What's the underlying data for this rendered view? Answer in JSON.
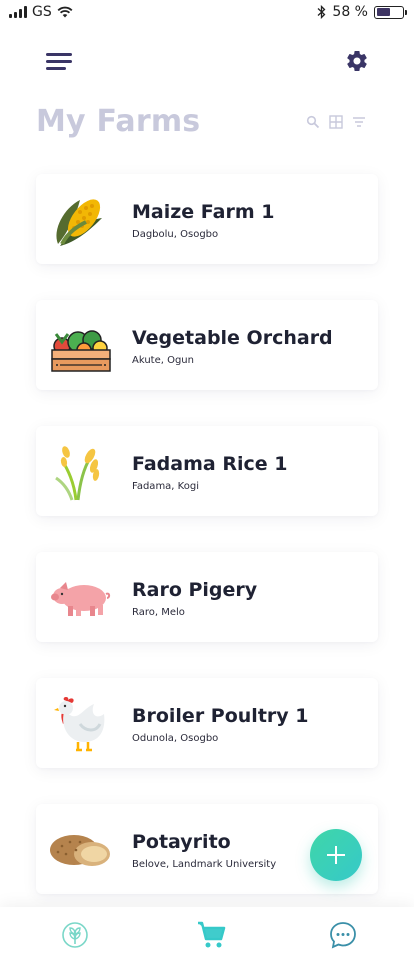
{
  "status": {
    "carrier": "GS",
    "battery_text": "58 %",
    "battery_level": 0.58
  },
  "header": {
    "title": "My Farms",
    "menu_icon": "hamburger-menu-icon",
    "settings_icon": "gear-icon",
    "tools": [
      "search-icon",
      "grid-view-icon",
      "filter-icon"
    ]
  },
  "farms": [
    {
      "name": "Maize Farm 1",
      "location": "Dagbolu, Osogbo",
      "icon": "maize-icon"
    },
    {
      "name": "Vegetable Orchard",
      "location": "Akute, Ogun",
      "icon": "vegetable-crate-icon"
    },
    {
      "name": "Fadama Rice 1",
      "location": "Fadama, Kogi",
      "icon": "rice-icon"
    },
    {
      "name": "Raro Pigery",
      "location": "Raro, Melo",
      "icon": "pig-icon"
    },
    {
      "name": "Broiler Poultry 1",
      "location": "Odunola, Osogbo",
      "icon": "chicken-icon"
    },
    {
      "name": "Potayrito",
      "location": "Belove, Landmark University",
      "icon": "potato-icon"
    }
  ],
  "fab": {
    "icon": "plus-icon"
  },
  "bottom_nav": [
    "farm-leaf-icon",
    "shopping-cart-icon",
    "chat-bubble-icon"
  ],
  "colors": {
    "accent": "#3fd6a8",
    "title": "#c8c9dc",
    "icon": "#3a3566"
  }
}
